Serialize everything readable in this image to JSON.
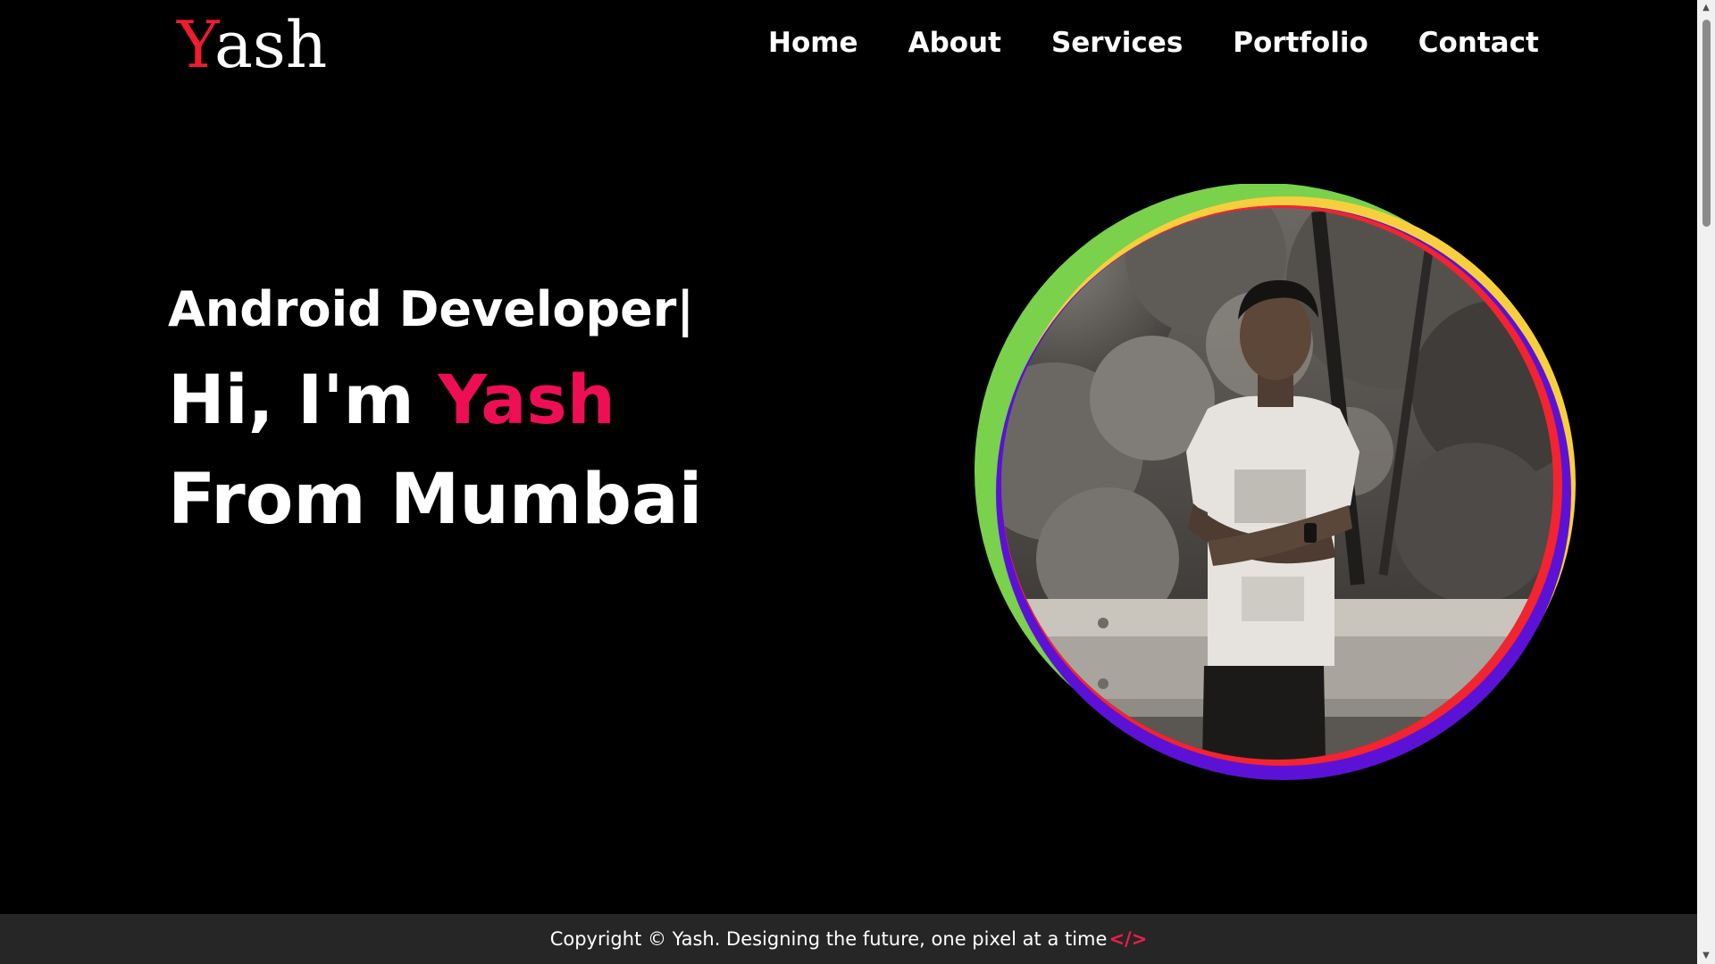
{
  "logo": {
    "first_letter": "Y",
    "rest": "ash"
  },
  "nav": {
    "items": [
      "Home",
      "About",
      "Services",
      "Portfolio",
      "Contact"
    ]
  },
  "hero": {
    "role": "Android Developer",
    "caret": "|",
    "greeting": "Hi, I'm",
    "name": "Yash",
    "location": "From Mumbai"
  },
  "footer": {
    "text": "Copyright © Yash. Designing the future, one pixel at a time",
    "code_glyph": "</>"
  },
  "colors": {
    "accent": "#ee0e55",
    "logo_accent": "#ee1c2e",
    "ring_green": "#7ad14b",
    "ring_yellow": "#f7cf3e",
    "ring_purple": "#5b12d6",
    "ring_red": "#f2242f",
    "footer_bg": "#262626"
  },
  "icons": {
    "scroll_up": "scroll-up-arrow-icon",
    "scroll_down": "scroll-down-arrow-icon",
    "code": "code-brackets-icon"
  }
}
